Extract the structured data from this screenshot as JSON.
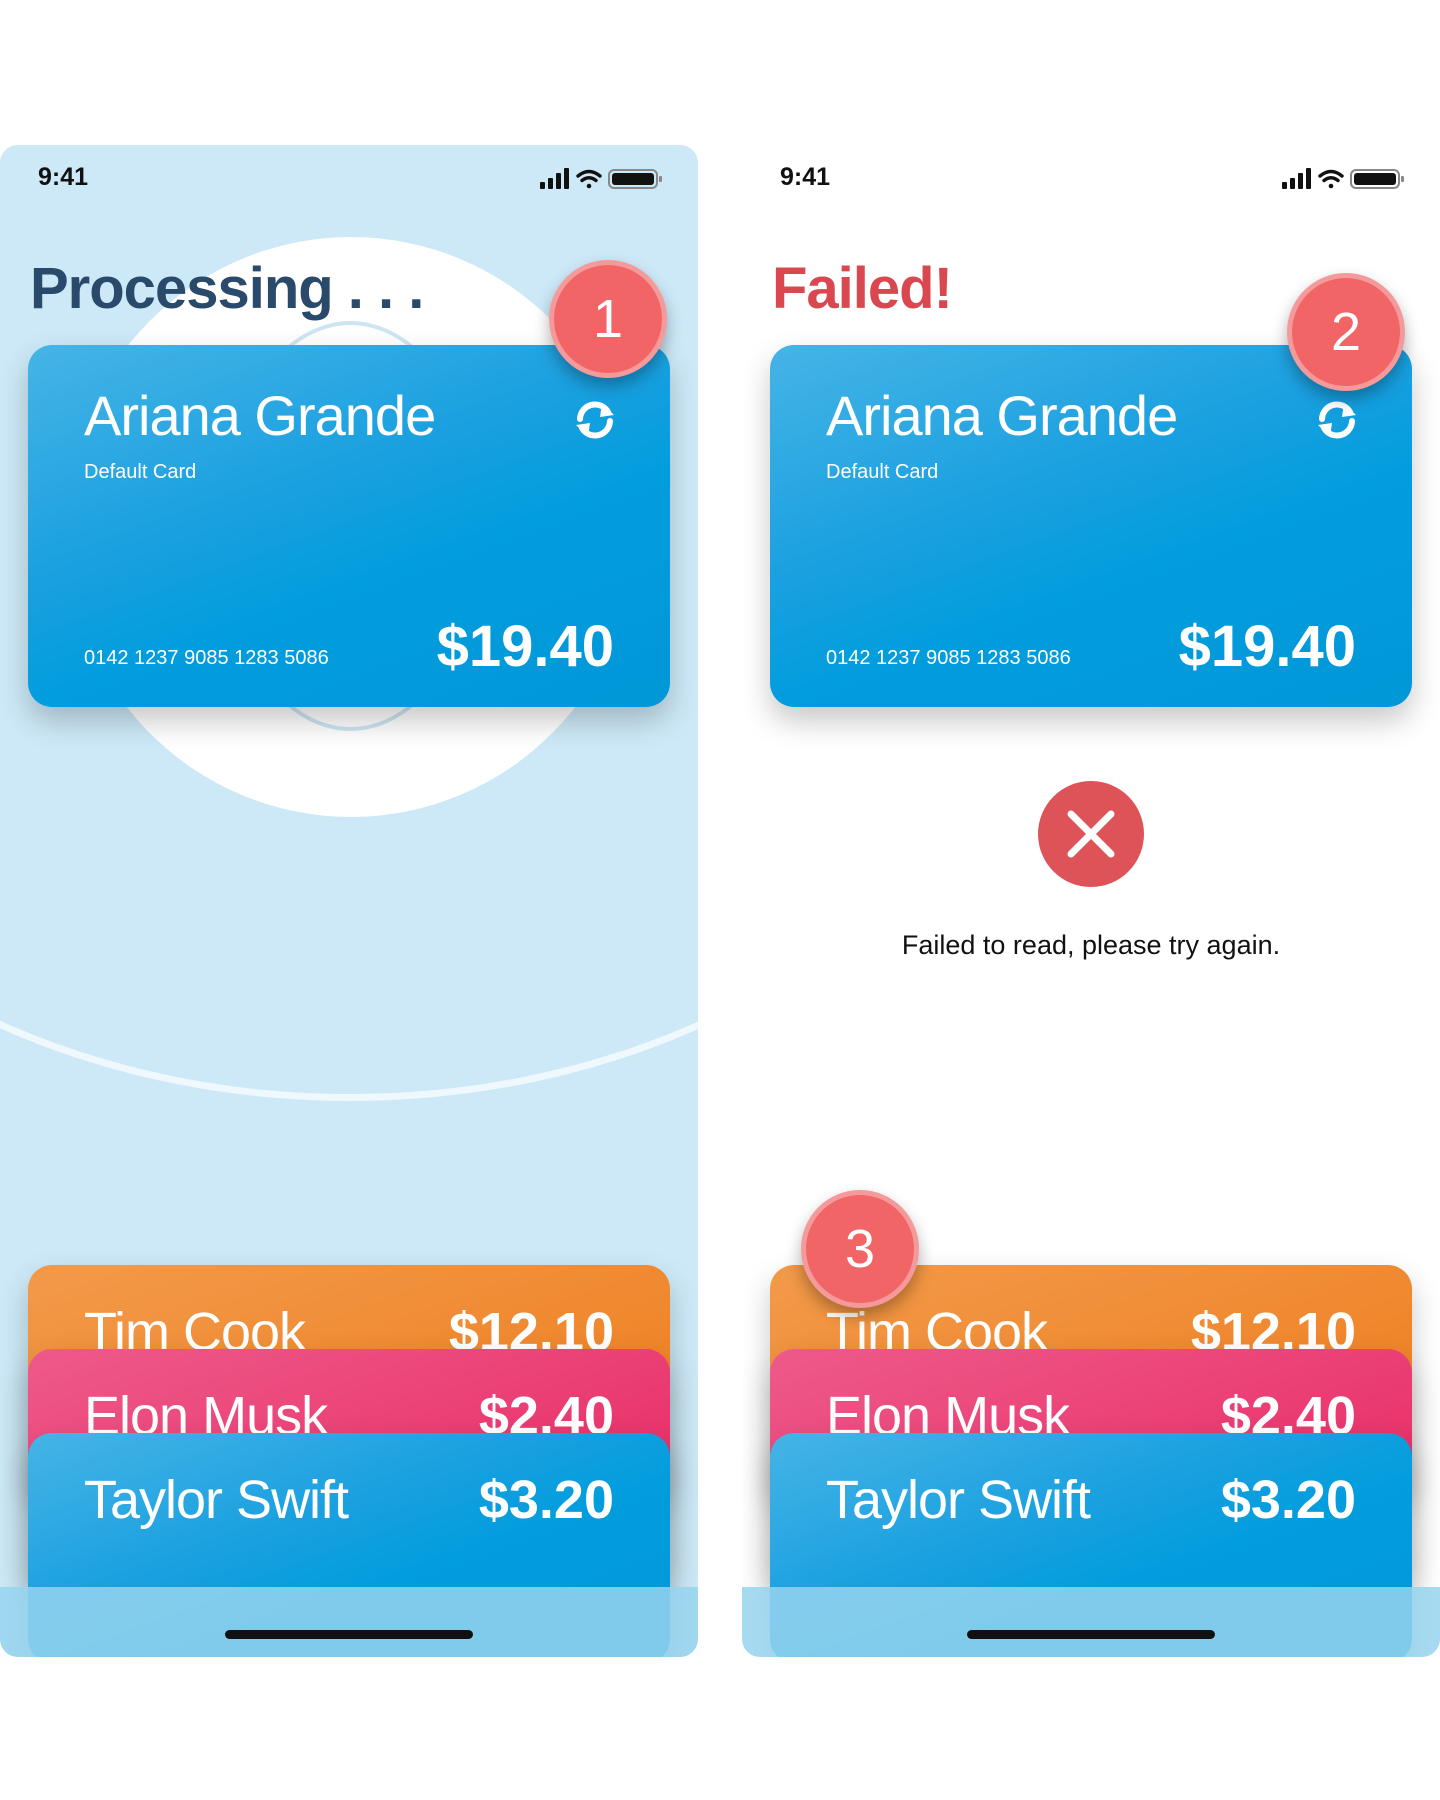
{
  "status_bar": {
    "time": "9:41"
  },
  "screen_processing": {
    "title": "Processing . . .",
    "card": {
      "name": "Ariana Grande",
      "subtitle": "Default Card",
      "number": "0142 1237 9085 1283 5086",
      "amount": "$19.40"
    },
    "badge": "1"
  },
  "screen_failed": {
    "title": "Failed!",
    "card": {
      "name": "Ariana Grande",
      "subtitle": "Default Card",
      "number": "0142 1237 9085 1283 5086",
      "amount": "$19.40"
    },
    "error_message": "Failed to read, please try again.",
    "badge_card": "2",
    "badge_stack": "3"
  },
  "stack_cards": [
    {
      "name": "Tim Cook",
      "amount": "$12.10",
      "color": "#ef7b1b"
    },
    {
      "name": "Elon Musk",
      "amount": "$2.40",
      "color": "#e7245f"
    },
    {
      "name": "Taylor Swift",
      "amount": "$3.20",
      "color": "#029ddd"
    }
  ],
  "colors": {
    "accent_blue": "#029ddd",
    "error_red": "#d9484f",
    "title_navy": "#2a4a6b",
    "badge": "#f26567"
  },
  "icons": [
    "signal-icon",
    "wifi-icon",
    "battery-icon",
    "refresh-icon",
    "close-x-icon"
  ]
}
